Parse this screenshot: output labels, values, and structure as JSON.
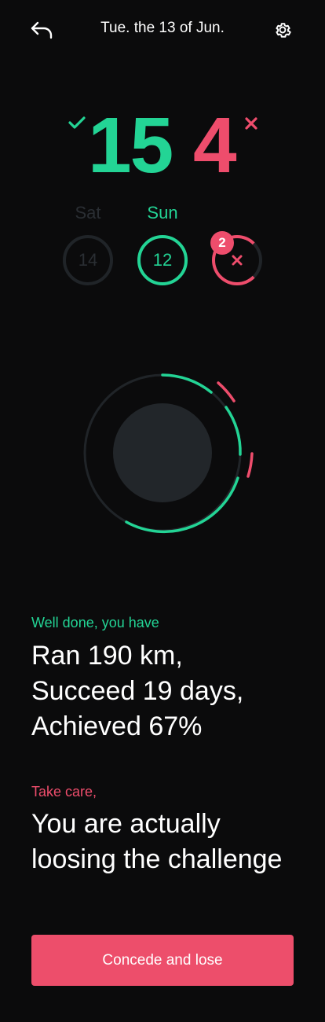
{
  "header": {
    "date_title": "Tue. the 13 of Jun."
  },
  "score": {
    "success_count": "15",
    "fail_count": "4"
  },
  "days": [
    {
      "label": "Sat",
      "number": "14"
    },
    {
      "label": "Sun",
      "number": "12"
    },
    {
      "label": "",
      "badge": "2"
    }
  ],
  "summary": {
    "caption": "Well done, you have",
    "lines": [
      "Ran 190 km,",
      "Succeed 19 days,",
      "Achieved 67%"
    ]
  },
  "warning": {
    "caption": "Take care,",
    "message": "You are actually loosing the challenge"
  },
  "action": {
    "concede_label": "Concede and lose"
  },
  "colors": {
    "background": "#0b0b0c",
    "success": "#23d495",
    "fail": "#ee4d6c",
    "muted": "#202428"
  },
  "icons": {
    "back": "undo-arrow-icon",
    "settings": "gear-icon",
    "success": "check-icon",
    "fail": "x-icon"
  }
}
